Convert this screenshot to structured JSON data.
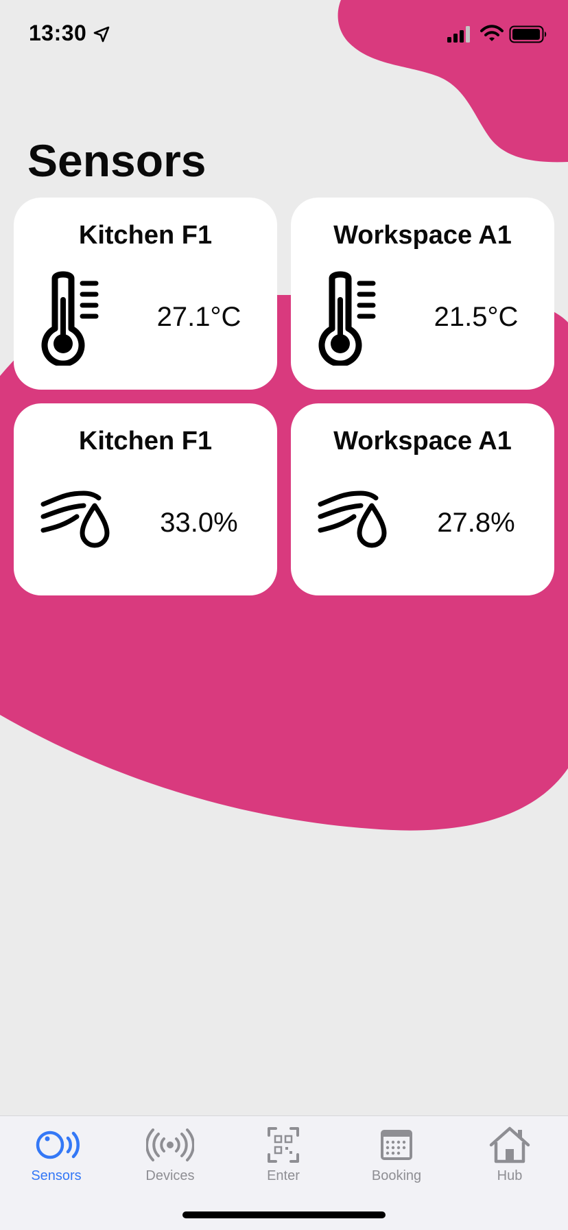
{
  "status_bar": {
    "time": "13:30"
  },
  "theme": {
    "accent": "#d93a7e",
    "background": "#ebebeb",
    "tab_active": "#3478f6",
    "tab_inactive": "#8e8e93"
  },
  "page": {
    "title": "Sensors"
  },
  "cards": [
    {
      "title": "Kitchen F1",
      "value": "27.1°C",
      "icon": "thermometer-icon"
    },
    {
      "title": "Workspace A1",
      "value": "21.5°C",
      "icon": "thermometer-icon"
    },
    {
      "title": "Kitchen F1",
      "value": "33.0%",
      "icon": "humidity-icon"
    },
    {
      "title": "Workspace A1",
      "value": "27.8%",
      "icon": "humidity-icon"
    }
  ],
  "tab_bar": {
    "items": [
      {
        "label": "Sensors",
        "icon": "sensor-icon",
        "active": true
      },
      {
        "label": "Devices",
        "icon": "broadcast-icon",
        "active": false
      },
      {
        "label": "Enter",
        "icon": "qr-code-icon",
        "active": false
      },
      {
        "label": "Booking",
        "icon": "calendar-icon",
        "active": false
      },
      {
        "label": "Hub",
        "icon": "home-icon",
        "active": false
      }
    ]
  }
}
